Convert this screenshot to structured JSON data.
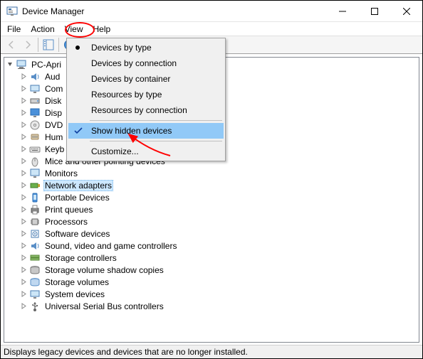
{
  "window": {
    "title": "Device Manager"
  },
  "menubar": {
    "file": "File",
    "action": "Action",
    "view": "View",
    "help": "Help"
  },
  "viewMenu": {
    "byType": "Devices by type",
    "byConnection": "Devices by connection",
    "byContainer": "Devices by container",
    "resByType": "Resources by type",
    "resByConn": "Resources by connection",
    "showHidden": "Show hidden devices",
    "customize": "Customize..."
  },
  "tree": {
    "root": "PC-Apri",
    "items": [
      "Aud",
      "Com",
      "Disk",
      "Disp",
      "DVD",
      "Hum",
      "Keyb",
      "Mice and other pointing devices",
      "Monitors",
      "Network adapters",
      "Portable Devices",
      "Print queues",
      "Processors",
      "Software devices",
      "Sound, video and game controllers",
      "Storage controllers",
      "Storage volume shadow copies",
      "Storage volumes",
      "System devices",
      "Universal Serial Bus controllers"
    ]
  },
  "statusbar": {
    "text": "Displays legacy devices and devices that are no longer installed."
  }
}
